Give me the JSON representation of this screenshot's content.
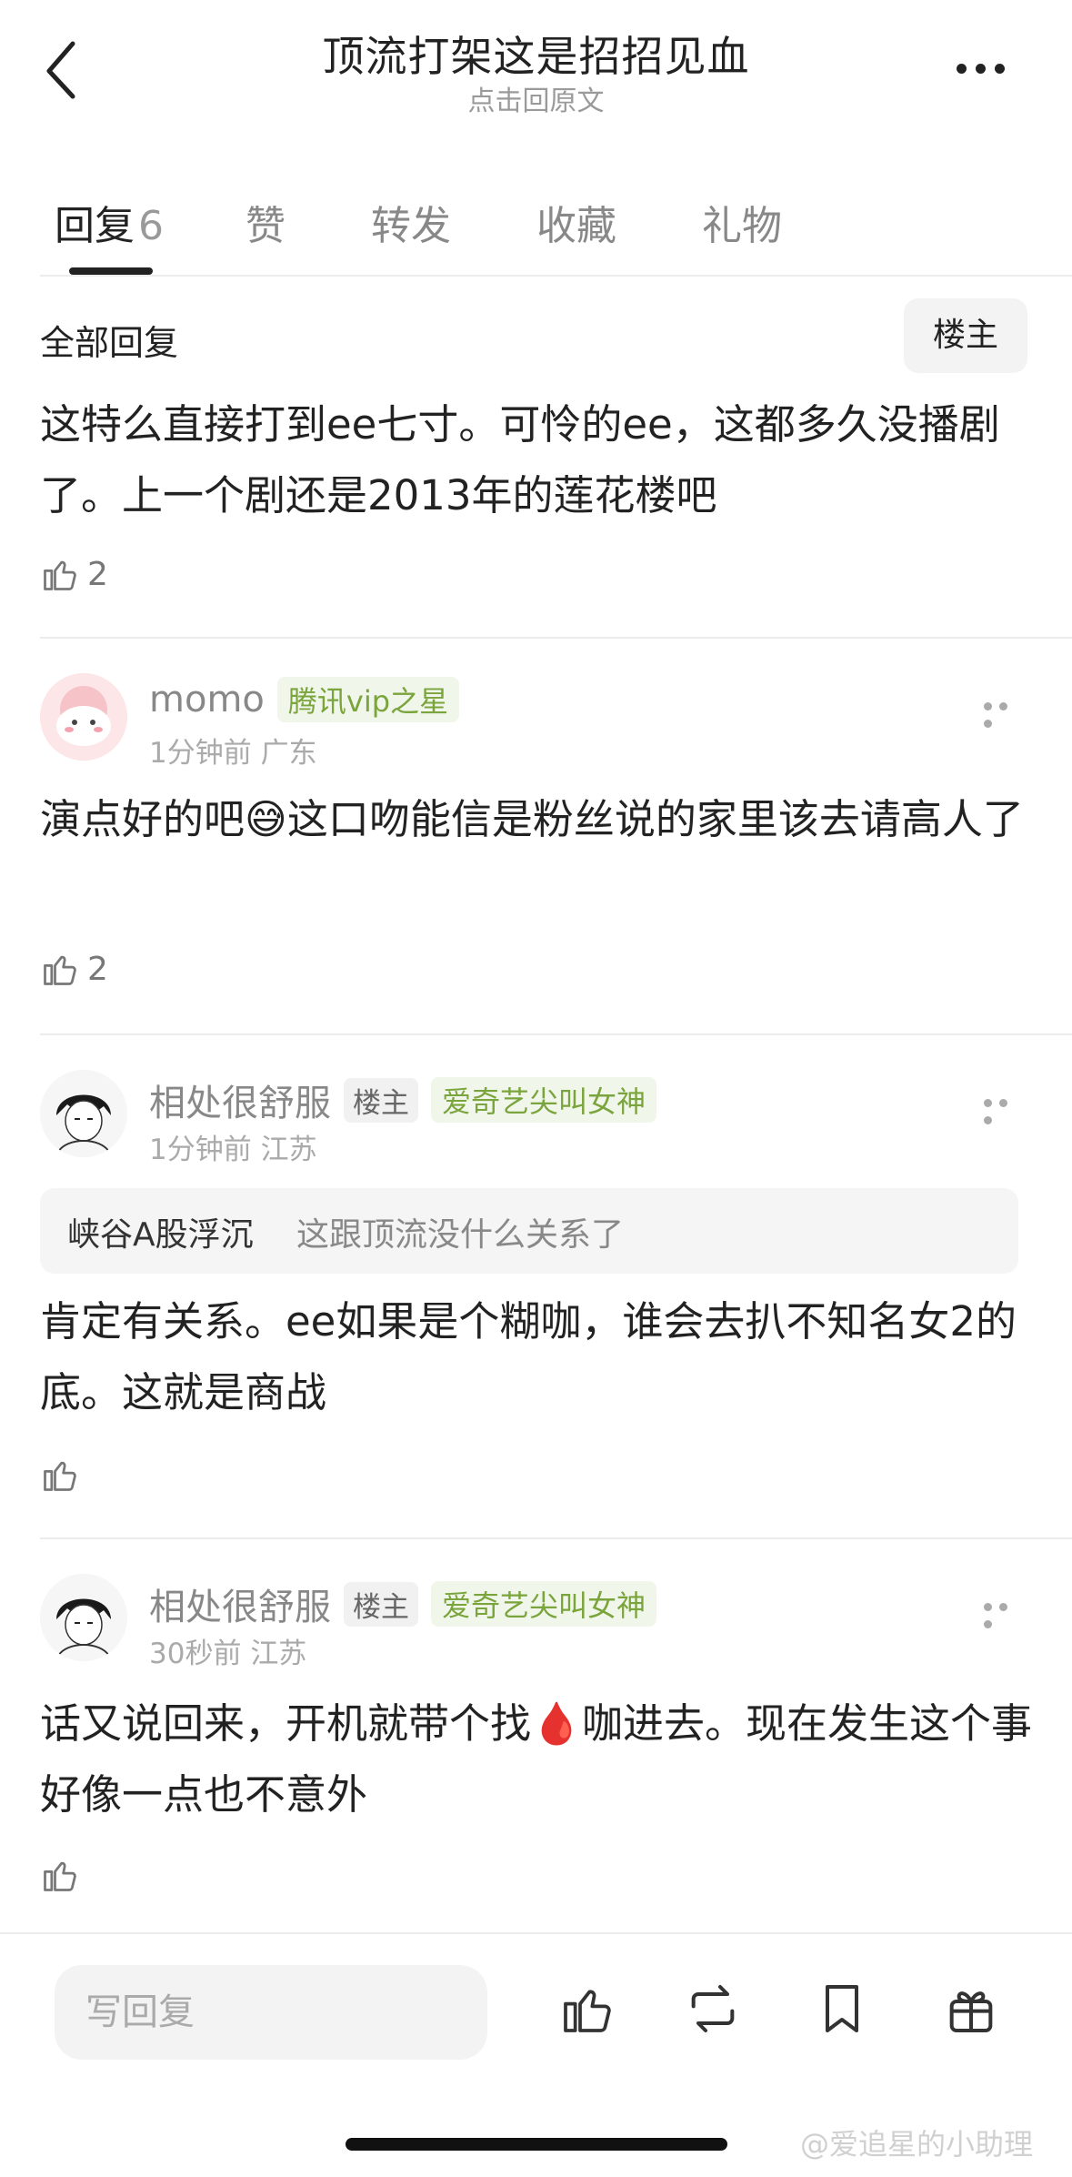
{
  "header": {
    "title": "顶流打架这是招招见血",
    "subtitle": "点击回原文"
  },
  "tabs": [
    {
      "label": "回复",
      "count": "6"
    },
    {
      "label": "赞"
    },
    {
      "label": "转发"
    },
    {
      "label": "收藏"
    },
    {
      "label": "礼物"
    }
  ],
  "section": {
    "title": "全部回复",
    "filter_label": "楼主"
  },
  "main_post": {
    "text": "这特么直接打到ee七寸。可怜的ee，这都多久没播剧了。上一个剧还是2013年的莲花楼吧",
    "likes": "2"
  },
  "replies": [
    {
      "username": "momo",
      "op_badge": "",
      "vip_badge": "腾讯vip之星",
      "time": "1分钟前",
      "location": "广东",
      "text": "演点好的吧😅这口吻能信是粉丝说的家里该去请高人了",
      "likes": "2"
    },
    {
      "username": "相处很舒服",
      "op_badge": "楼主",
      "vip_badge": "爱奇艺尖叫女神",
      "time": "1分钟前",
      "location": "江苏",
      "quote_user": "峡谷A股浮沉",
      "quote_text": "这跟顶流没什么关系了",
      "text": "肯定有关系。ee如果是个糊咖，谁会去扒不知名女2的底。这就是商战",
      "likes": ""
    },
    {
      "username": "相处很舒服",
      "op_badge": "楼主",
      "vip_badge": "爱奇艺尖叫女神",
      "time": "30秒前",
      "location": "江苏",
      "text": "话又说回来，开机就带个找🩸咖进去。现在发生这个事好像一点也不意外",
      "likes": ""
    }
  ],
  "bottom": {
    "reply_placeholder": "写回复"
  },
  "watermark": "@爱追星的小助理",
  "icons": [
    "back-arrow-icon",
    "more-icon",
    "thumbs-up-icon",
    "repost-icon",
    "bookmark-icon",
    "gift-icon"
  ]
}
